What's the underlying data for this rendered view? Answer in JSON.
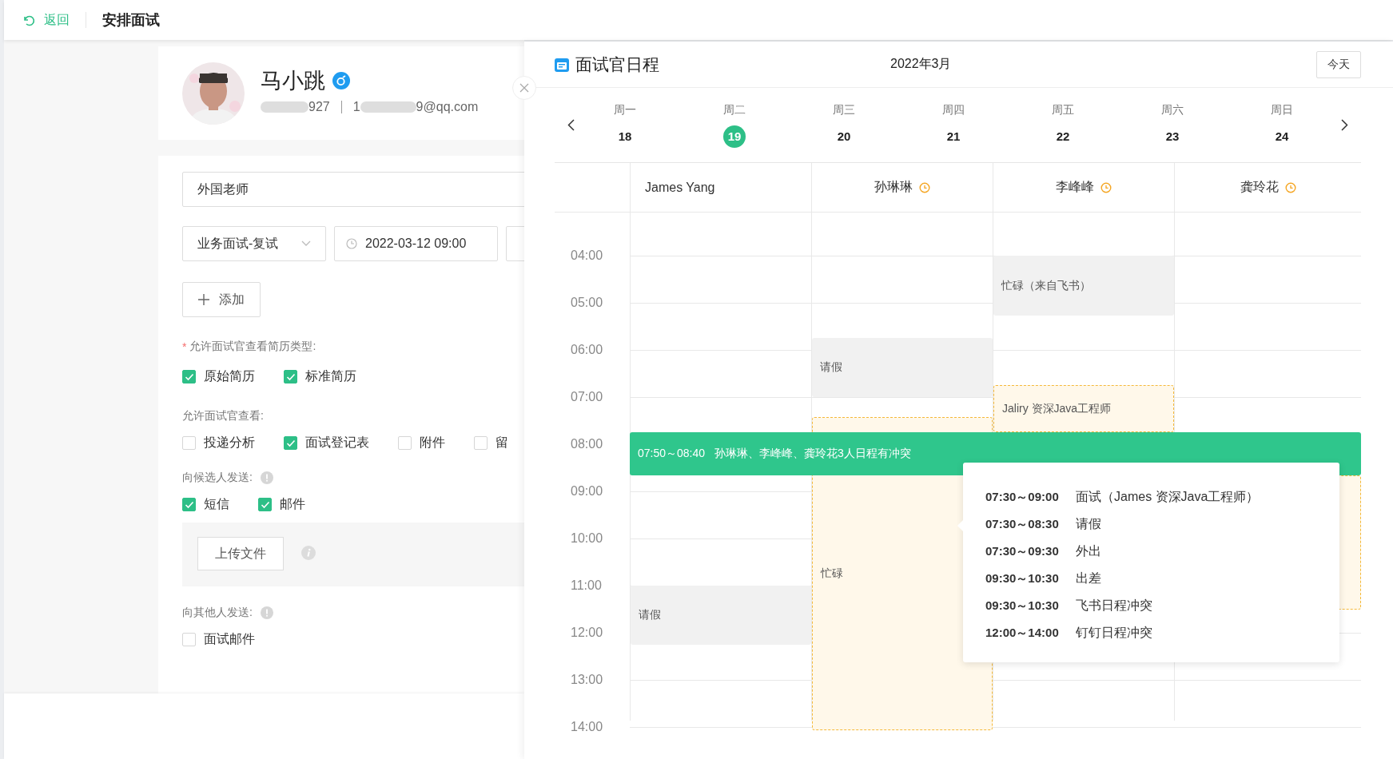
{
  "header": {
    "back": "返回",
    "title": "安排面试"
  },
  "candidate": {
    "name": "马小跳",
    "phone_end": "927",
    "email_start": "1",
    "email_end": "9@qq.com"
  },
  "form": {
    "position": {
      "value": "外国老师"
    },
    "interview_round": {
      "value": "业务面试-复试"
    },
    "start_time": {
      "value": "2022-03-12 09:00"
    },
    "add_button": "添加",
    "resume_types": {
      "required_mark": "*",
      "label": "允许面试官查看简历类型:",
      "options": [
        {
          "label": "原始简历",
          "checked": true
        },
        {
          "label": "标准简历",
          "checked": true
        }
      ]
    },
    "viewable": {
      "label": "允许面试官查看:",
      "options": [
        {
          "label": "投递分析",
          "checked": false
        },
        {
          "label": "面试登记表",
          "checked": true
        },
        {
          "label": "附件",
          "checked": false
        },
        {
          "label": "留",
          "checked": false
        }
      ]
    },
    "notify_candidate": {
      "label": "向候选人发送:",
      "options": [
        {
          "label": "短信",
          "checked": true
        },
        {
          "label": "邮件",
          "checked": true
        }
      ],
      "upload_button": "上传文件"
    },
    "notify_others": {
      "label": "向其他人发送:",
      "options": [
        {
          "label": "面试邮件",
          "checked": false
        }
      ]
    }
  },
  "schedule": {
    "title": "面试官日程",
    "month": "2022年3月",
    "today_button": "今天",
    "days": [
      {
        "weekday": "周一",
        "date": "18",
        "selected": false
      },
      {
        "weekday": "周二",
        "date": "19",
        "selected": true
      },
      {
        "weekday": "周三",
        "date": "20",
        "selected": false
      },
      {
        "weekday": "周四",
        "date": "21",
        "selected": false
      },
      {
        "weekday": "周五",
        "date": "22",
        "selected": false
      },
      {
        "weekday": "周六",
        "date": "23",
        "selected": false
      },
      {
        "weekday": "周日",
        "date": "24",
        "selected": false
      }
    ],
    "hours": [
      "04:00",
      "05:00",
      "06:00",
      "07:00",
      "08:00",
      "09:00",
      "10:00",
      "11:00",
      "12:00",
      "13:00",
      "14:00"
    ],
    "interviewers": [
      {
        "name": "James Yang",
        "clock": false,
        "events": [
          {
            "kind": "busy",
            "label": "请假"
          }
        ]
      },
      {
        "name": "孙琳琳",
        "clock": true,
        "events": [
          {
            "kind": "busy",
            "label": "请假"
          },
          {
            "kind": "pending",
            "label": "忙碌"
          }
        ]
      },
      {
        "name": "李峰峰",
        "clock": true,
        "events": [
          {
            "kind": "busy",
            "label": "忙碌（来自飞书）"
          },
          {
            "kind": "pending",
            "label": "Jaliry 资深Java工程师"
          }
        ]
      },
      {
        "name": "龚玲花",
        "clock": true,
        "events": [
          {
            "kind": "pending"
          }
        ]
      }
    ],
    "conflict": {
      "time": "07:50～08:40",
      "text": "孙琳琳、李峰峰、龚玲花3人日程有冲突"
    },
    "conflict_details": [
      {
        "time": "07:30～09:00",
        "label": "面试（James 资深Java工程师）"
      },
      {
        "time": "07:30～08:30",
        "label": "请假"
      },
      {
        "time": "07:30～09:30",
        "label": "外出"
      },
      {
        "time": "09:30～10:30",
        "label": "出差"
      },
      {
        "time": "09:30～10:30",
        "label": "飞书日程冲突"
      },
      {
        "time": "12:00～14:00",
        "label": "钉钉日程冲突"
      }
    ]
  }
}
